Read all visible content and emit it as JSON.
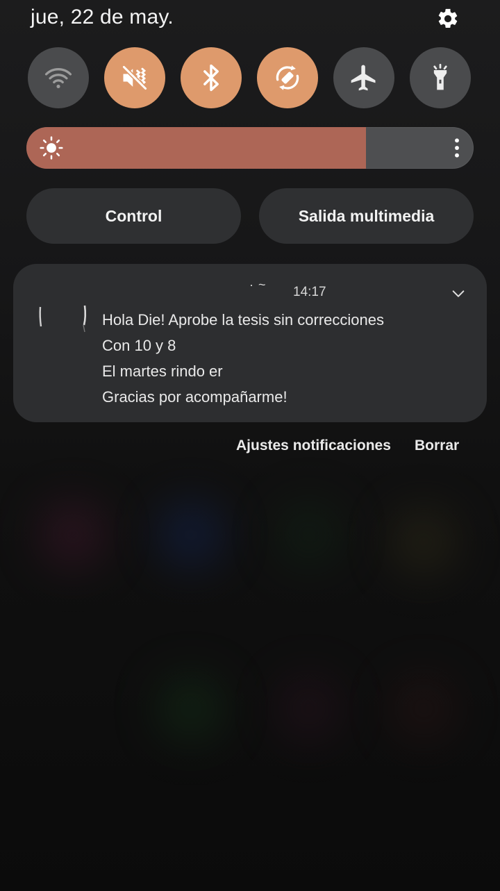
{
  "header": {
    "date": "jue, 22 de may.",
    "settings_icon": "gear-icon"
  },
  "quick_settings": [
    {
      "name": "wifi",
      "icon": "wifi-icon",
      "state": "off"
    },
    {
      "name": "sound",
      "icon": "vibrate-mute-icon",
      "state": "on"
    },
    {
      "name": "bluetooth",
      "icon": "bluetooth-icon",
      "state": "on"
    },
    {
      "name": "auto-rotate",
      "icon": "auto-rotate-icon",
      "state": "on"
    },
    {
      "name": "airplane-mode",
      "icon": "airplane-icon",
      "state": "off"
    },
    {
      "name": "flashlight",
      "icon": "flashlight-icon",
      "state": "off"
    }
  ],
  "brightness": {
    "level": 0.76,
    "icon": "sun-icon",
    "menu_icon": "more-vert-icon"
  },
  "buttons": {
    "control": "Control",
    "media_output": "Salida multimedia"
  },
  "notification": {
    "app_name": "· ~",
    "time": "14:17",
    "lines": [
      "Hola Die! Aprobe la tesis sin correcciones",
      "Con 10 y 8",
      "El martes rindo er",
      "Gracias por acompañarme!"
    ]
  },
  "notification_actions": {
    "settings": "Ajustes notificaciones",
    "clear": "Borrar"
  },
  "colors": {
    "toggle_on": "#de9a6c",
    "toggle_off": "#4a4b4d",
    "brightness_fill": "#ad6656"
  }
}
